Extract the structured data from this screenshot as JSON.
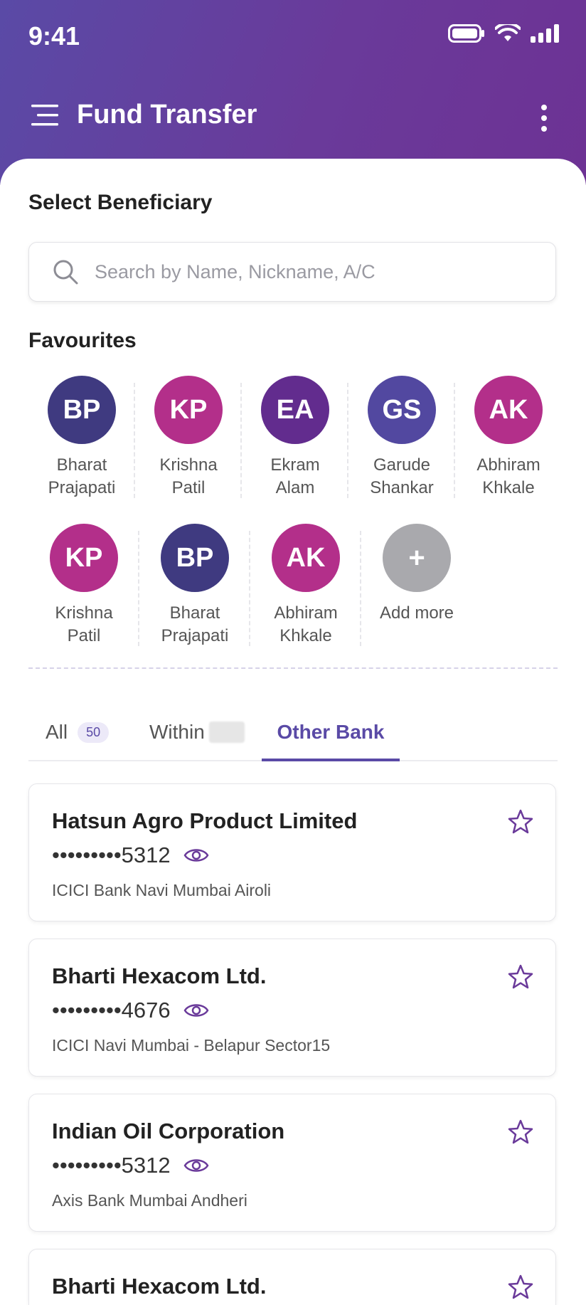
{
  "status": {
    "time": "9:41"
  },
  "header": {
    "title": "Fund Transfer"
  },
  "beneficiary": {
    "section_title": "Select Beneficiary",
    "search_placeholder": "Search by Name, Nickname, A/C"
  },
  "favourites": {
    "title": "Favourites",
    "rows": [
      [
        {
          "initials": "BP",
          "line1": "Bharat",
          "line2": "Prajapati",
          "color": "#3f3a80"
        },
        {
          "initials": "KP",
          "line1": "Krishna",
          "line2": "Patil",
          "color": "#b32f8a"
        },
        {
          "initials": "EA",
          "line1": "Ekram",
          "line2": "Alam",
          "color": "#622c8e"
        },
        {
          "initials": "GS",
          "line1": "Garude",
          "line2": "Shankar",
          "color": "#5248a0"
        },
        {
          "initials": "AK",
          "line1": "Abhiram",
          "line2": "Khkale",
          "color": "#b32f8a"
        }
      ],
      [
        {
          "initials": "KP",
          "line1": "Krishna",
          "line2": "Patil",
          "color": "#b32f8a"
        },
        {
          "initials": "BP",
          "line1": "Bharat",
          "line2": "Prajapati",
          "color": "#3f3a80"
        },
        {
          "initials": "AK",
          "line1": "Abhiram",
          "line2": "Khkale",
          "color": "#b32f8a"
        },
        {
          "initials": "+",
          "line1": "Add more",
          "line2": "",
          "color": "#a9a9ad"
        }
      ]
    ]
  },
  "tabs": [
    {
      "label": "All",
      "badge": "50"
    },
    {
      "label": "Within"
    },
    {
      "label": "Other Bank",
      "active": true
    }
  ],
  "beneficiaries": [
    {
      "name": "Hatsun Agro Product Limited",
      "account": "•••••••••5312",
      "bank": "ICICI Bank Navi Mumbai Airoli"
    },
    {
      "name": "Bharti Hexacom Ltd.",
      "account": "•••••••••4676",
      "bank": "ICICI Navi Mumbai - Belapur Sector15"
    },
    {
      "name": "Indian Oil Corporation",
      "account": "•••••••••5312",
      "bank": "Axis Bank Mumbai Andheri"
    },
    {
      "name": "Bharti Hexacom Ltd.",
      "account": "",
      "bank": ""
    }
  ],
  "colors": {
    "brand": "#5a4aa6",
    "header_end": "#6d3294"
  }
}
